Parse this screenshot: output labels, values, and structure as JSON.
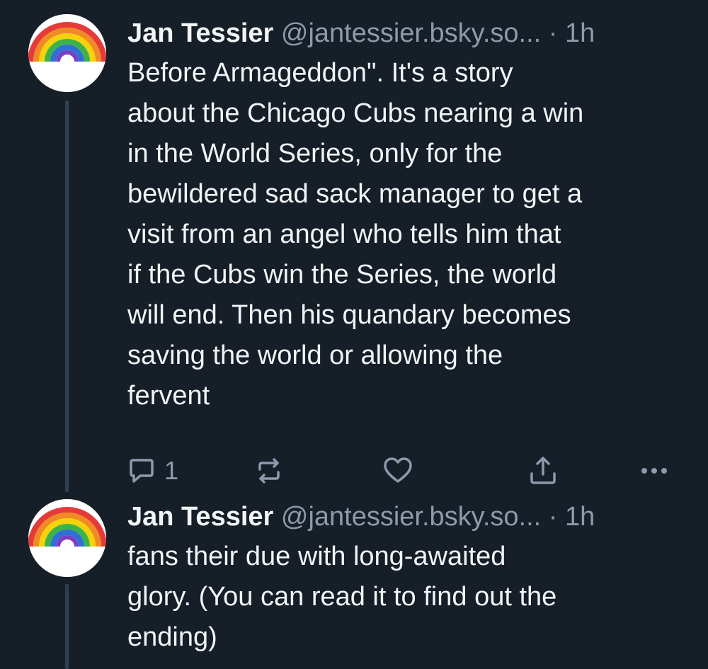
{
  "posts": [
    {
      "author": "Jan Tessier",
      "handle": "@jantessier.bsky.so...",
      "separator": "·",
      "time": "1h",
      "text": "Before Armageddon\". It's a story\nabout the Chicago Cubs nearing a win\nin the World Series, only for the\nbewildered sad sack manager to get a\nvisit from an angel who tells him that\nif the Cubs win the Series, the world\nwill end. Then his quandary becomes\nsaving the world or allowing the\nfervent",
      "reply_count": "1",
      "actions": [
        "reply-icon",
        "repost-icon",
        "like-icon",
        "share-icon",
        "more-icon"
      ]
    },
    {
      "author": "Jan Tessier",
      "handle": "@jantessier.bsky.so...",
      "separator": "·",
      "time": "1h",
      "text": "fans their due with long-awaited\nglory. (You can read it to find out the\nending)"
    }
  ],
  "colors": {
    "background": "#161e27",
    "text": "#f1f3f5",
    "muted": "#8d9aab",
    "thread_line": "#2e4052"
  }
}
